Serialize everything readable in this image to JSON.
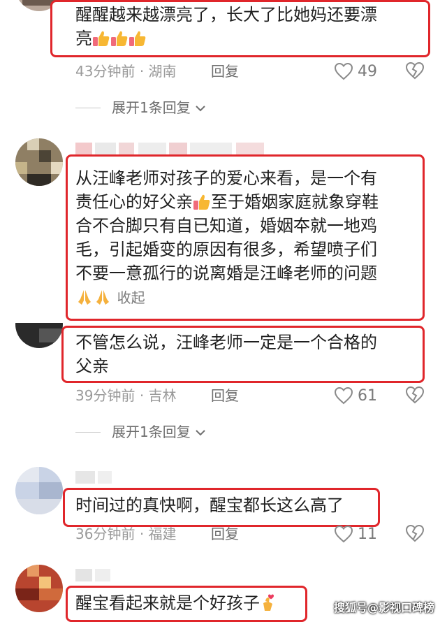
{
  "comments": [
    {
      "text_line1": "醒醒越来越漂亮了，长大了比她妈还要漂",
      "text_line2": "亮",
      "time": "43分钟前",
      "location": "湖南",
      "reply_label": "回复",
      "likes": "49",
      "expand_label": "展开1条回复"
    },
    {
      "text_line1": "从汪峰老师对孩子的爱心来看，是一个有",
      "text_line2": "责任心的好父亲",
      "text_line2b": "至于婚姻家庭就象穿鞋",
      "text_line3": "合不合脚只有自已知道，婚姻夲就一地鸡",
      "text_line4": "毛，引起婚变的原因有很多，希望喷子们",
      "text_line5": "不要一意孤行的说离婚是汪峰老师的问题",
      "collapse_label": "收起"
    },
    {
      "text_line1": "不管怎么说，汪峰老师一定是一个合格的",
      "text_line2": "父亲",
      "time": "39分钟前",
      "location": "吉林",
      "reply_label": "回复",
      "likes": "61",
      "expand_label": "展开1条回复"
    },
    {
      "text_line1": "时间过的真快啊，醒宝都长这么高了",
      "time": "36分钟前",
      "location": "福建",
      "reply_label": "回复",
      "likes": "11"
    },
    {
      "text_line1": "醒宝看起来就是个好孩子"
    }
  ],
  "separator": "·",
  "watermark": "搜狐号@影视口碑榜",
  "colors": {
    "highlight_border": "#e0262b",
    "meta_gray": "#9a9a9a"
  }
}
